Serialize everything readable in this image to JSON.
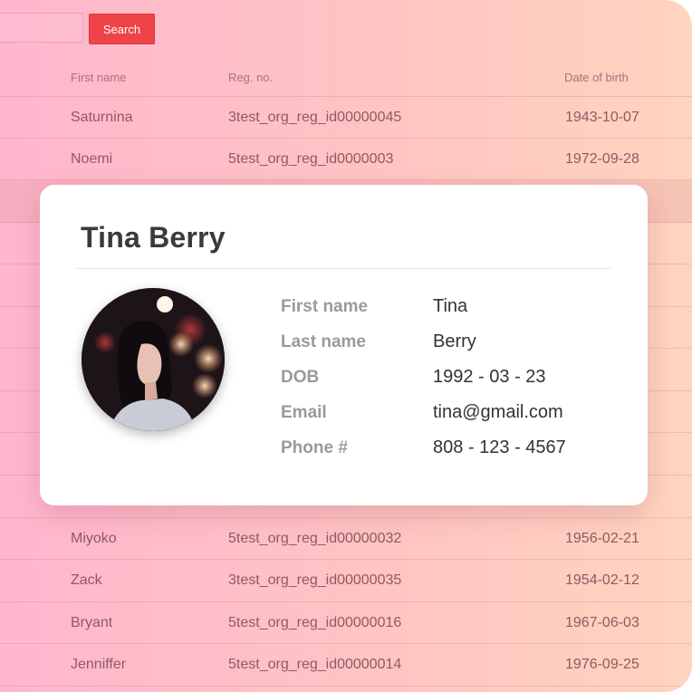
{
  "toolbar": {
    "search_placeholder": "",
    "search_button_label": "Search"
  },
  "table": {
    "columns": [
      "First name",
      "Reg. no.",
      "Date of birth"
    ],
    "rows_top": [
      {
        "first_name": "Saturnina",
        "reg_no": "3test_org_reg_id00000045",
        "dob": "1943-10-07"
      },
      {
        "first_name": "Noemi",
        "reg_no": "5test_org_reg_id0000003",
        "dob": "1972-09-28"
      }
    ],
    "rows_bottom": [
      {
        "first_name": "Miyoko",
        "reg_no": "5test_org_reg_id00000032",
        "dob": "1956-02-21"
      },
      {
        "first_name": "Zack",
        "reg_no": "3test_org_reg_id00000035",
        "dob": "1954-02-12"
      },
      {
        "first_name": "Bryant",
        "reg_no": "5test_org_reg_id00000016",
        "dob": "1967-06-03"
      },
      {
        "first_name": "Jenniffer",
        "reg_no": "5test_org_reg_id00000014",
        "dob": "1976-09-25"
      }
    ]
  },
  "card": {
    "title": "Tina Berry",
    "fields": [
      {
        "label": "First name",
        "value": "Tina"
      },
      {
        "label": "Last name",
        "value": "Berry"
      },
      {
        "label": "DOB",
        "value": "1992 - 03 - 23"
      },
      {
        "label": "Email",
        "value": "tina@gmail.com"
      },
      {
        "label": "Phone #",
        "value": "808 - 123 - 4567"
      }
    ]
  },
  "colors": {
    "accent": "#ee4447",
    "background_start": "#ffb6ce",
    "background_end": "#ffd4bf"
  }
}
